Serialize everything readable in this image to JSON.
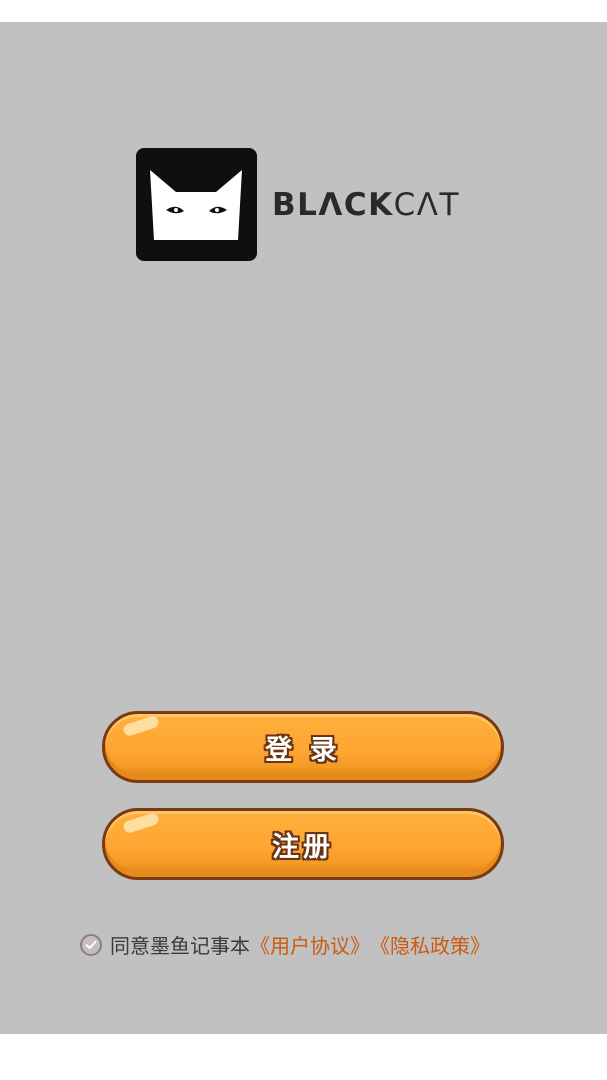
{
  "brand": {
    "name_bold": "BLΛCK",
    "name_light": "CΛT",
    "logo_icon": "black-cat-icon"
  },
  "actions": {
    "login_label": "登 录",
    "register_label": "注册"
  },
  "agreement": {
    "checkbox_icon": "check-circle-icon",
    "text": "同意墨鱼记事本",
    "user_agreement": "《用户协议》",
    "privacy_policy": "《隐私政策》"
  },
  "colors": {
    "background": "#c1c1c1",
    "button": "#ffa532",
    "button_border": "#7a3a10",
    "link": "#cc5a10"
  }
}
